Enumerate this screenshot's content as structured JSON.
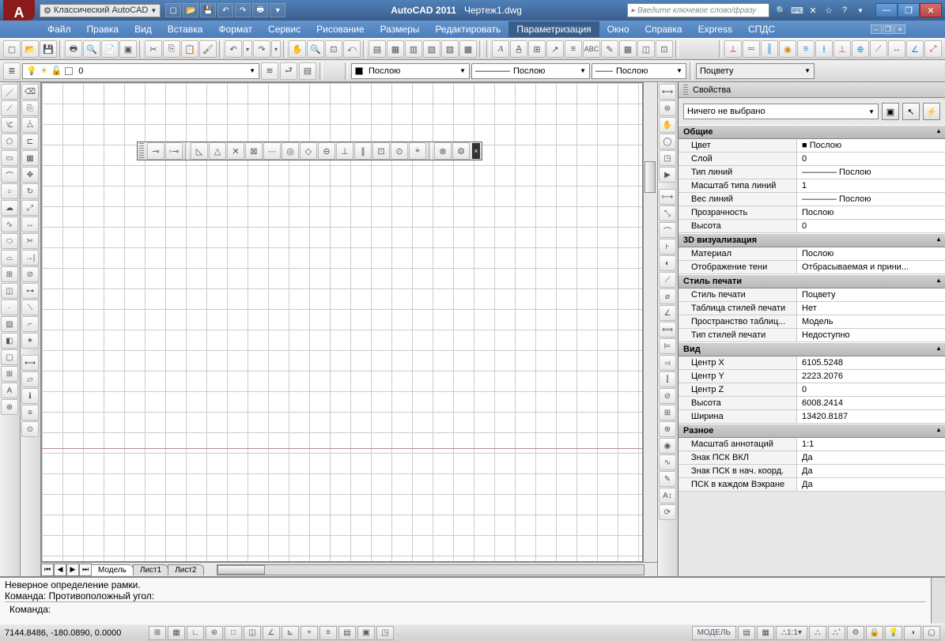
{
  "title": {
    "app": "AutoCAD 2011",
    "doc": "Чертеж1.dwg",
    "workspace": "Классический AutoCAD",
    "search_placeholder": "Введите ключевое слово/фразу"
  },
  "menu": [
    "Файл",
    "Правка",
    "Вид",
    "Вставка",
    "Формат",
    "Сервис",
    "Рисование",
    "Размеры",
    "Редактировать",
    "Параметризация",
    "Окно",
    "Справка",
    "Express",
    "СПДС"
  ],
  "menu_active_index": 9,
  "layer": {
    "current": "0",
    "linetype": "Послою",
    "lineweight": "Послою",
    "color": "Послою",
    "plotstyle": "Поцвету"
  },
  "sheet_tabs": [
    "Модель",
    "Лист1",
    "Лист2"
  ],
  "cmd": {
    "history1": "Неверное определение рамки.",
    "history2": "Команда: Противоположный угол:",
    "prompt": "Команда:"
  },
  "status": {
    "coords": "7144.8486, -180.0890, 0.0000",
    "model": "МОДЕЛЬ",
    "scale": "1:1"
  },
  "props": {
    "title": "Свойства",
    "selection": "Ничего не выбрано",
    "groups": [
      {
        "name": "Общие",
        "rows": [
          [
            "Цвет",
            "■ Послою"
          ],
          [
            "Слой",
            "0"
          ],
          [
            "Тип линий",
            "———— Послою"
          ],
          [
            "Масштаб типа линий",
            "1"
          ],
          [
            "Вес линий",
            "———— Послою"
          ],
          [
            "Прозрачность",
            "Послою"
          ],
          [
            "Высота",
            "0"
          ]
        ]
      },
      {
        "name": "3D визуализация",
        "rows": [
          [
            "Материал",
            "Послою"
          ],
          [
            "Отображение тени",
            "Отбрасываемая и прини..."
          ]
        ]
      },
      {
        "name": "Стиль печати",
        "rows": [
          [
            "Стиль печати",
            "Поцвету"
          ],
          [
            "Таблица стилей печати",
            "Нет"
          ],
          [
            "Пространство таблиц...",
            "Модель"
          ],
          [
            "Тип стилей печати",
            "Недоступно"
          ]
        ]
      },
      {
        "name": "Вид",
        "rows": [
          [
            "Центр X",
            "6105.5248"
          ],
          [
            "Центр Y",
            "2223.2076"
          ],
          [
            "Центр Z",
            "0"
          ],
          [
            "Высота",
            "6008.2414"
          ],
          [
            "Ширина",
            "13420.8187"
          ]
        ]
      },
      {
        "name": "Разное",
        "rows": [
          [
            "Масштаб аннотаций",
            "1:1"
          ],
          [
            "Знак ПСК ВКЛ",
            "Да"
          ],
          [
            "Знак ПСК в нач. коорд.",
            "Да"
          ],
          [
            "ПСК в каждом Вэкране",
            "Да"
          ]
        ]
      }
    ]
  }
}
